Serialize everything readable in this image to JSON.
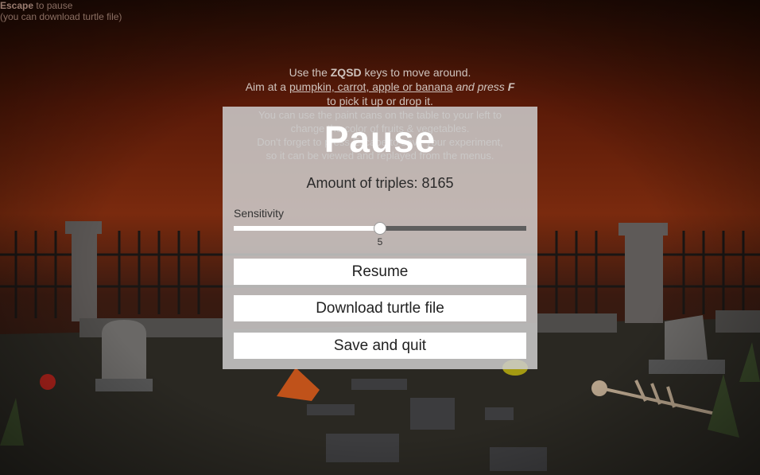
{
  "hud": {
    "escape_key": "Escape",
    "escape_rest": " to pause",
    "download_hint": "(you can download turtle file)"
  },
  "instructions": {
    "line1_pre": "Use the ",
    "line1_key": "ZQSD",
    "line1_post": " keys to move around.",
    "line2_pre": "Aim at a ",
    "line2_items": "pumpkin, carrot, apple or banana",
    "line2_mid": "  and press ",
    "line2_key": "F",
    "line3": "to pick it up or drop it.",
    "line4": "You can use the paint cans on the table to your left to",
    "line5": "change the color of fruits & vegetables.",
    "line6": "Don't forget to press Escape to save your experiment,",
    "line7": "so it can be viewed and replayed from the menus."
  },
  "pause_menu": {
    "title": "Pause",
    "triples_label": "Amount of triples: 8165",
    "sensitivity_label": "Sensitivity",
    "sensitivity_value": "5",
    "sensitivity_fraction": 0.5,
    "resume_label": "Resume",
    "download_label": "Download turtle file",
    "save_quit_label": "Save and quit"
  }
}
